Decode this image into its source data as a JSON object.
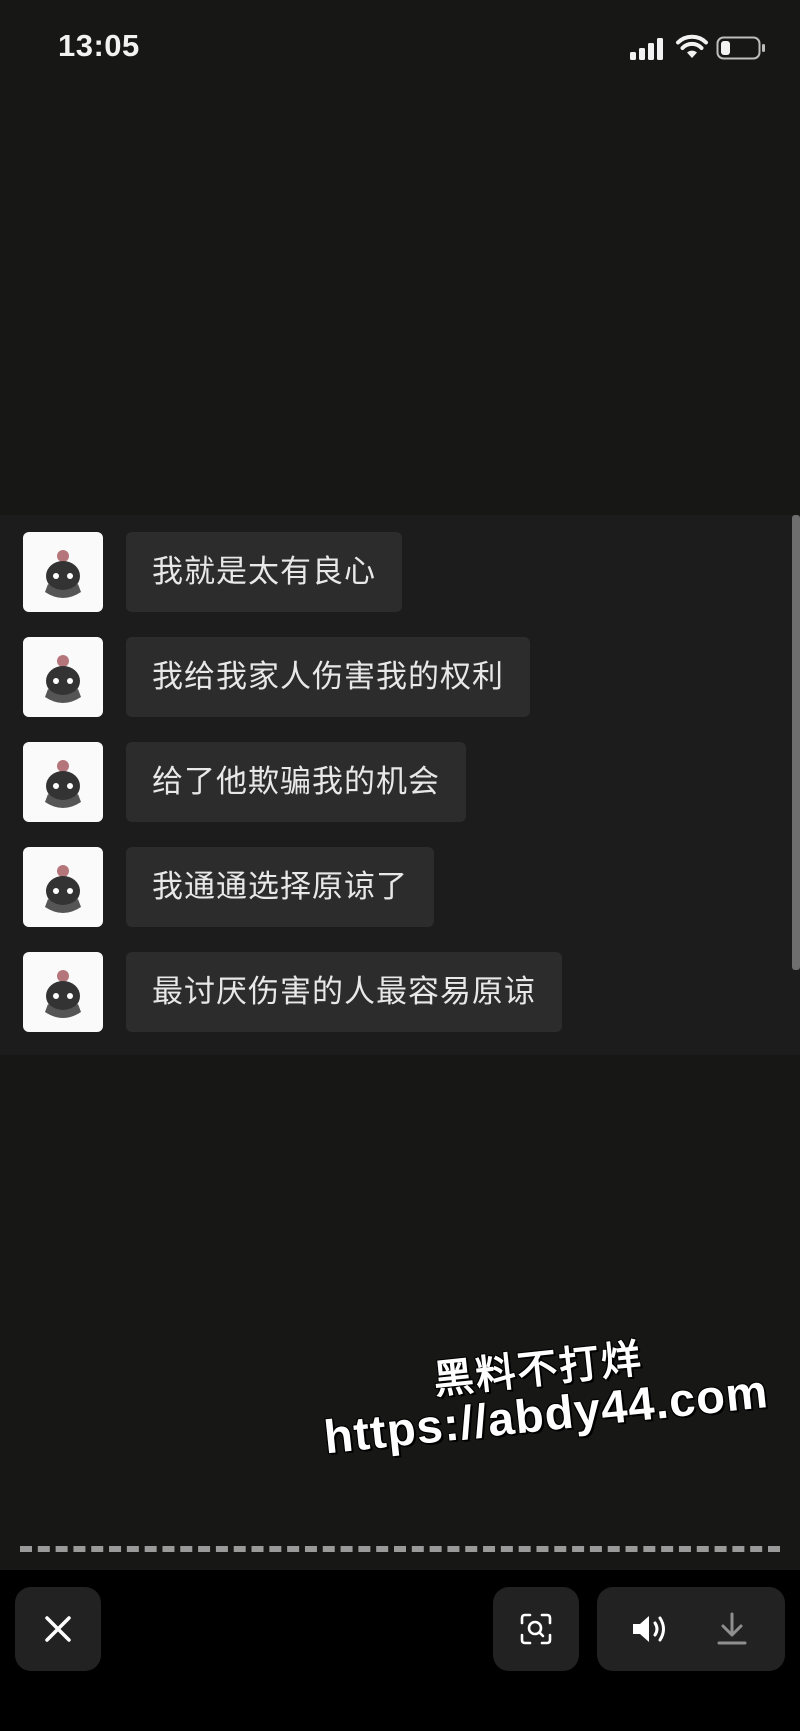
{
  "status_bar": {
    "time": "13:05",
    "icons": [
      "signal-icon",
      "wifi-icon",
      "battery-icon"
    ]
  },
  "chat": {
    "messages": [
      {
        "text": "我就是太有良心"
      },
      {
        "text": "我给我家人伤害我的权利"
      },
      {
        "text": "给了他欺骗我的机会"
      },
      {
        "text": "我通通选择原谅了"
      },
      {
        "text": "最讨厌伤害的人最容易原谅"
      }
    ]
  },
  "watermark": {
    "line1": "黑料不打烊",
    "line2": "https://abdy44.com"
  },
  "toolbar": {
    "icons": [
      "close-icon",
      "scan-icon",
      "volume-icon",
      "download-icon"
    ]
  },
  "colors": {
    "background": "#171716",
    "chat_panel": "#1c1c1c",
    "bubble": "#2c2c2c",
    "toolbar": "#000000",
    "button": "#222222"
  }
}
